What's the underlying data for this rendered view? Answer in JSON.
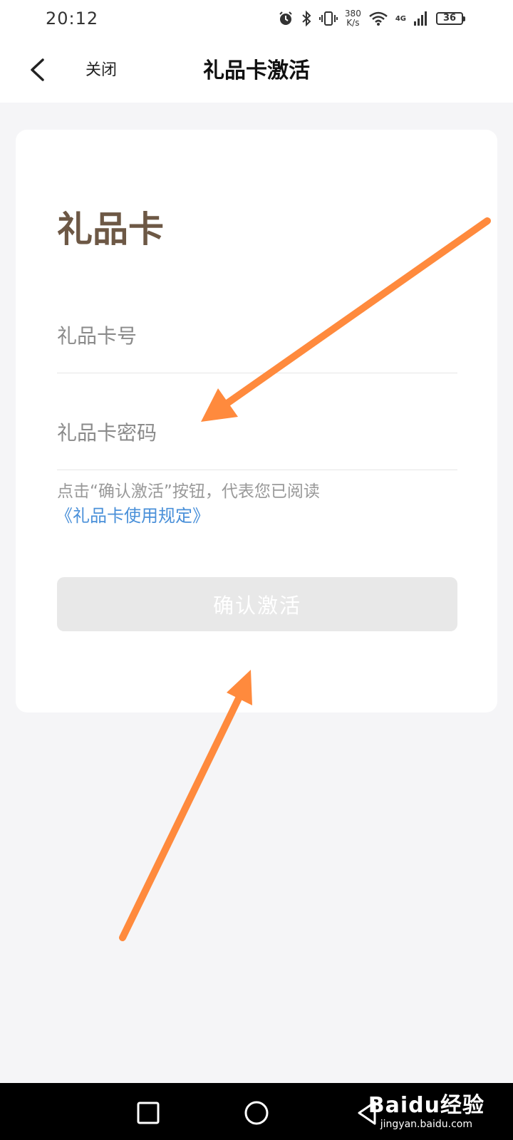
{
  "status_bar": {
    "time": "20:12",
    "net_speed_value": "380",
    "net_speed_unit": "K/s",
    "network": "4G",
    "battery": "36",
    "icons": [
      "alarm-icon",
      "bluetooth-icon",
      "vibrate-icon",
      "wifi-icon",
      "signal-icon",
      "battery-icon"
    ]
  },
  "nav": {
    "back_icon": "chevron-left-icon",
    "close_label": "关闭",
    "title": "礼品卡激活"
  },
  "card": {
    "title": "礼品卡",
    "card_number_placeholder": "礼品卡号",
    "card_password_placeholder": "礼品卡密码",
    "agreement_text": "点击“确认激活”按钮，代表您已阅读",
    "agreement_link": "《礼品卡使用规定》",
    "confirm_label": "确认激活"
  },
  "system_nav": {
    "buttons": [
      "recents-icon",
      "home-icon",
      "back-icon"
    ]
  },
  "watermark": {
    "brand": "Baidu经验",
    "url": "jingyan.baidu.com"
  },
  "colors": {
    "accent_title": "#6d5845",
    "link": "#4a90d9",
    "button_disabled": "#e8e8e8",
    "annotation_arrow": "#ff8a3d",
    "background": "#f5f5f7"
  }
}
